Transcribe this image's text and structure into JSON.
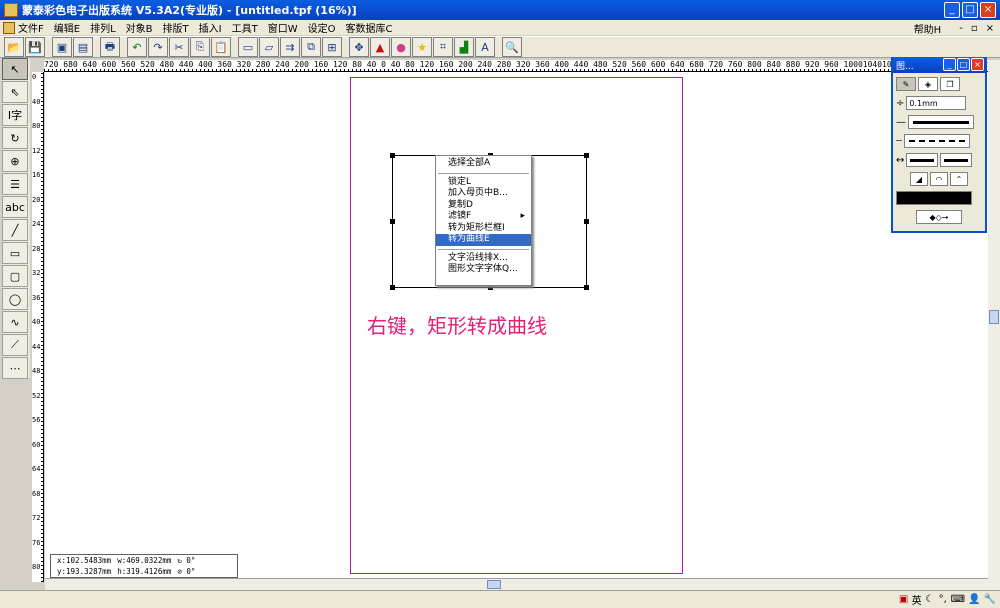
{
  "window": {
    "title": "蒙泰彩色电子出版系统 V5.3A2(专业版) - [untitled.tpf (16%)]",
    "minimize": "_",
    "maximize": "□",
    "close": "×"
  },
  "menu": {
    "items": [
      "文件F",
      "编辑E",
      "排列L",
      "对象B",
      "排版T",
      "插入I",
      "工具T",
      "窗口W",
      "设定O",
      "客数据库C"
    ],
    "help": "帮助H",
    "mdi_min": "-",
    "mdi_restore": "▫",
    "mdi_close": "×"
  },
  "rulers": {
    "horizontal": "720 680 640 600 560 520 480 440 400 360 320 280 240 200 160 120  80  40   0   40  80  120 160 200 240 280 320 360 400 440 480 520 560 600 640 680 720 760 800 840 880 920 960 1000104010801120116012001240128013",
    "vertical": [
      "0",
      "40",
      "80",
      "12",
      "16",
      "20",
      "24",
      "28",
      "32",
      "36",
      "40",
      "44",
      "48",
      "52",
      "56",
      "60",
      "64",
      "68",
      "72",
      "76",
      "80",
      "84",
      "88",
      "92",
      "96",
      "00",
      "04",
      "08",
      "12",
      "16",
      "20"
    ]
  },
  "context_menu": {
    "items": [
      {
        "label": "选择全部A",
        "highlighted": false,
        "submenu": false
      },
      {
        "separator": true
      },
      {
        "label": "锁定L",
        "highlighted": false,
        "submenu": false
      },
      {
        "label": "加入母页中B...",
        "highlighted": false,
        "submenu": false
      },
      {
        "label": "复制D",
        "highlighted": false,
        "submenu": false
      },
      {
        "label": "滤镜F",
        "highlighted": false,
        "submenu": true
      },
      {
        "label": "转为矩形栏框I",
        "highlighted": false,
        "submenu": false
      },
      {
        "label": "转为曲线E",
        "highlighted": true,
        "submenu": false
      },
      {
        "separator": true
      },
      {
        "label": "文字沿线排X...",
        "highlighted": false,
        "submenu": false
      },
      {
        "label": "图形文字字体Q...",
        "highlighted": false,
        "submenu": false
      }
    ]
  },
  "annotation": "右键，矩形转成曲线",
  "status_box": {
    "x": "x:102.5483mm",
    "w": "w:469.0322mm",
    "rot": "↻ 0°",
    "y": "y:193.3287mm",
    "h": "h:319.4126mm",
    "skew": "⊘ 0°"
  },
  "panel": {
    "title": "图...",
    "line_width": "0.1mm"
  },
  "tray": {
    "ime": "英"
  },
  "colors": {
    "title_blue": "#0a4fd0",
    "page_border": "#a020a0",
    "annotation": "#e0207a",
    "highlight": "#316ac5"
  }
}
